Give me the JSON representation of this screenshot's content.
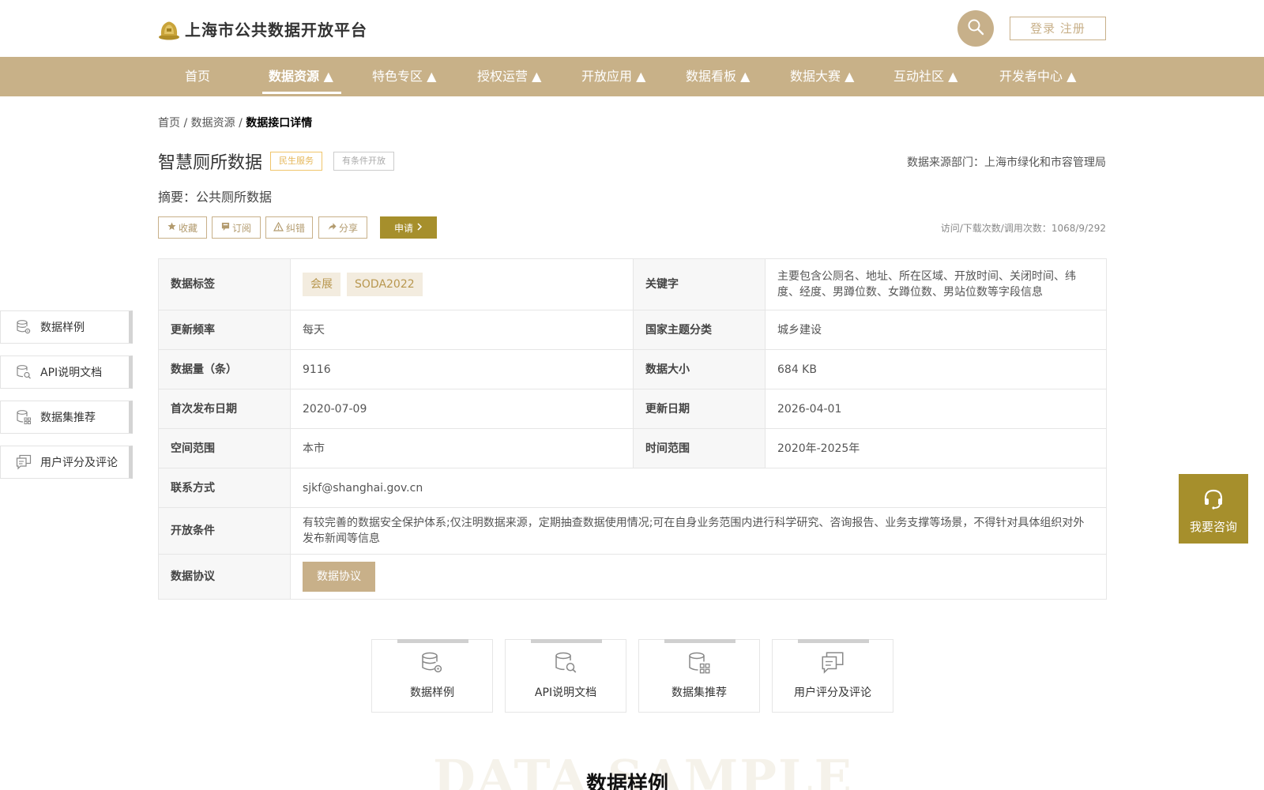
{
  "header": {
    "logo_icon": "gold-seal-logo-icon",
    "site_title": "上海市公共数据开放平台",
    "search_icon": "search-icon",
    "login_label": "登录 注册"
  },
  "nav": {
    "items": [
      {
        "label": "首页"
      },
      {
        "label": "数据资源 ▲"
      },
      {
        "label": "特色专区 ▲"
      },
      {
        "label": "授权运营 ▲"
      },
      {
        "label": "开放应用 ▲"
      },
      {
        "label": "数据看板 ▲"
      },
      {
        "label": "数据大赛 ▲"
      },
      {
        "label": "互动社区 ▲"
      },
      {
        "label": "开发者中心 ▲"
      }
    ],
    "active_index": 1
  },
  "breadcrumb": {
    "home": "首页",
    "sep": " / ",
    "section": "数据资源",
    "current": "数据接口详情"
  },
  "dataset": {
    "title": "智慧厕所数据",
    "tags": [
      "民生服务",
      "有条件开放"
    ],
    "source_dept": "数据来源部门：上海市绿化和市容管理局",
    "summary": "摘要：公共厕所数据",
    "counts": "访问/下载次数/调用次数：1068/9/292"
  },
  "actions": {
    "favorite": "收藏",
    "subscribe": "订阅",
    "correct": "纠错",
    "share": "分享",
    "apply": "申请"
  },
  "info": {
    "labels": {
      "tags": "数据标签",
      "keywords": "关键字",
      "frequency": "更新频率",
      "theme": "国家主题分类",
      "count": "数据量（条）",
      "size": "数据大小",
      "first_release": "首次发布日期",
      "updated": "更新日期",
      "space": "空间范围",
      "time": "时间范围",
      "contact": "联系方式",
      "condition": "开放条件",
      "protocol": "数据协议"
    },
    "tag_chips": [
      "会展",
      "SODA2022"
    ],
    "keywords": "主要包含公厕名、地址、所在区域、开放时间、关闭时间、纬度、经度、男蹲位数、女蹲位数、男站位数等字段信息",
    "frequency": "每天",
    "theme": "城乡建设",
    "count": "9116",
    "size": "684 KB",
    "first_release": "2020-07-09",
    "updated": "2026-04-01",
    "space": "本市",
    "time": "2020年-2025年",
    "contact": "sjkf@shanghai.gov.cn",
    "condition": "有较完善的数据安全保护体系;仅注明数据来源，定期抽查数据使用情况;可在自身业务范围内进行科学研究、咨询报告、业务支撑等场景，不得针对具体组织对外发布新闻等信息",
    "protocol_button": "数据协议"
  },
  "side_nav": [
    {
      "label": "数据样例",
      "icon": "database-gear-icon"
    },
    {
      "label": "API说明文档",
      "icon": "document-search-icon"
    },
    {
      "label": "数据集推荐",
      "icon": "database-grid-icon"
    },
    {
      "label": "用户评分及评论",
      "icon": "comment-icon"
    }
  ],
  "consult": {
    "label": "我要咨询",
    "icon": "headset-icon"
  },
  "cards": [
    {
      "label": "数据样例",
      "icon": "database-gear-icon"
    },
    {
      "label": "API说明文档",
      "icon": "document-search-icon"
    },
    {
      "label": "数据集推荐",
      "icon": "database-grid-icon"
    },
    {
      "label": "用户评分及评论",
      "icon": "comment-icon"
    }
  ],
  "section": {
    "watermark": "DATA SAMPLE",
    "title": "数据样例"
  }
}
